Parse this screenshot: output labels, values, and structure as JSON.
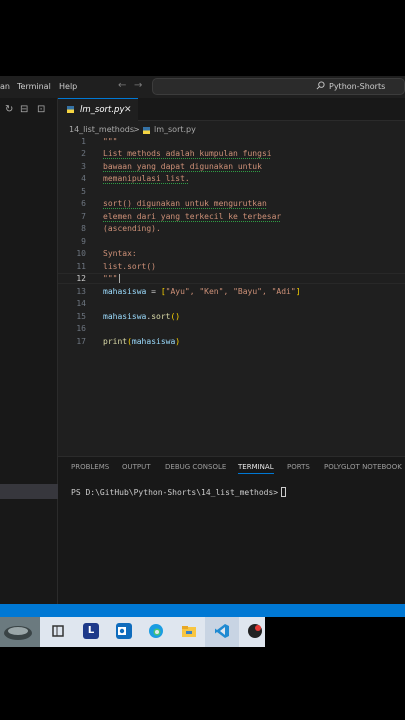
{
  "menu": {
    "partial_first": "an",
    "terminal": "Terminal",
    "help": "Help",
    "search_text": "Python-Shorts"
  },
  "tab": {
    "label": "lm_sort.py",
    "close": "✕"
  },
  "breadcrumb": {
    "folder": "14_list_methods",
    "sep": ">",
    "file": "lm_sort.py"
  },
  "code": {
    "line_numbers": [
      "1",
      "2",
      "3",
      "4",
      "5",
      "6",
      "7",
      "8",
      "9",
      "10",
      "11",
      "12",
      "13",
      "14",
      "15",
      "16",
      "17"
    ],
    "l1": "\"\"\"",
    "l2": "List methods adalah kumpulan fungsi",
    "l3": "bawaan yang dapat digunakan untuk",
    "l4": "memanipulasi list.",
    "l6": "sort() digunakan untuk mengurutkan",
    "l7": "elemen dari yang terkecil ke terbesar",
    "l8": "(ascending).",
    "l10": "Syntax:",
    "l11": "list.sort()",
    "l12": "\"\"\"",
    "l13_var": "mahasiswa",
    "l13_eq": " = ",
    "l13_open": "[",
    "l13_items": "\"Ayu\", \"Ken\", \"Bayu\", \"Adi\"",
    "l13_close": "]",
    "l15_var": "mahasiswa",
    "l15_dot": ".",
    "l15_fn": "sort",
    "l15_paren": "()",
    "l17_fn": "print",
    "l17_open": "(",
    "l17_var": "mahasiswa",
    "l17_close": ")"
  },
  "panel": {
    "tabs": [
      "PROBLEMS",
      "OUTPUT",
      "DEBUG CONSOLE",
      "TERMINAL",
      "PORTS",
      "POLYGLOT NOTEBOOK"
    ],
    "active_tab": "TERMINAL",
    "prompt": "PS D:\\GitHub\\Python-Shorts\\14_list_methods> "
  },
  "taskbar": {
    "icons": [
      "widgets-icon",
      "task-view-icon",
      "lens-app-icon",
      "outlook-icon",
      "edge-icon",
      "file-explorer-icon",
      "vscode-icon",
      "app-icon"
    ]
  },
  "colors": {
    "accent": "#0078d4",
    "editor_bg": "#1f1f1f",
    "string": "#ce9178",
    "variable": "#9cdcfe",
    "function": "#dcdcaa"
  }
}
